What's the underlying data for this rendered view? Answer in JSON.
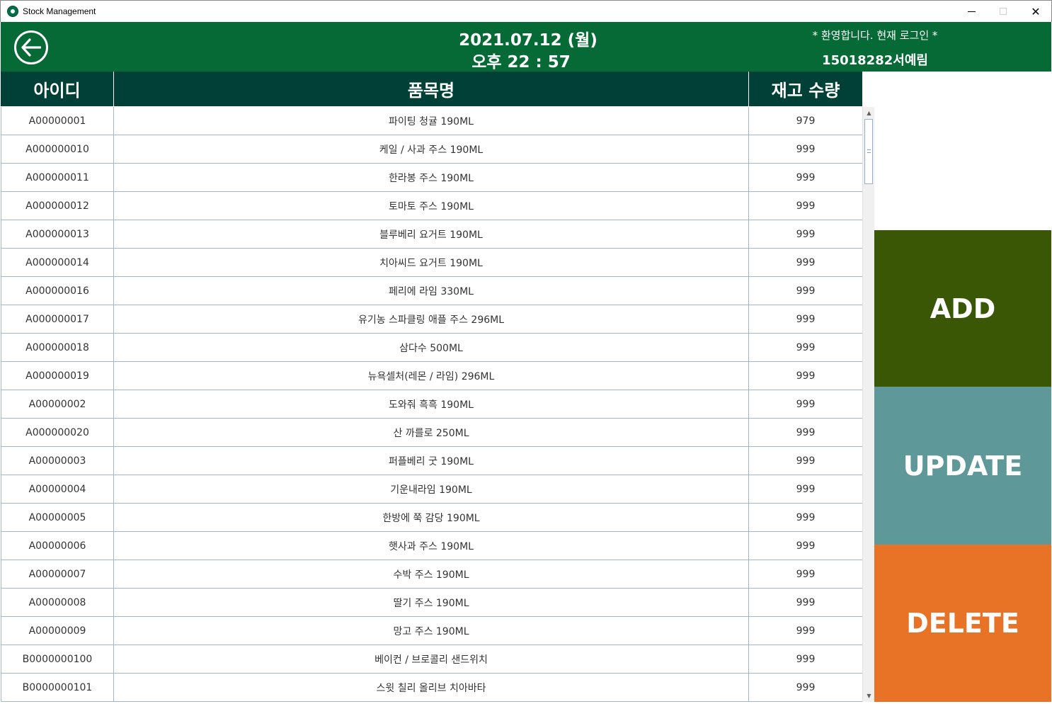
{
  "window": {
    "title": "Stock Management",
    "min_glyph": "",
    "max_glyph": "",
    "close_glyph": "✕"
  },
  "header": {
    "date": "2021.07.12 (월)",
    "time": "오후 22 : 57",
    "welcome": "* 환영합니다. 현재 로그인 *",
    "user": "15018282서예림"
  },
  "table": {
    "columns": [
      "아이디",
      "품목명",
      "재고 수량"
    ],
    "rows": [
      {
        "id": "A00000001",
        "name": "파이팅 청귤 190ML",
        "qty": "979"
      },
      {
        "id": "A000000010",
        "name": "케일 / 사과 주스 190ML",
        "qty": "999"
      },
      {
        "id": "A000000011",
        "name": "한라봉 주스 190ML",
        "qty": "999"
      },
      {
        "id": "A000000012",
        "name": "토마토 주스 190ML",
        "qty": "999"
      },
      {
        "id": "A000000013",
        "name": "블루베리 요거트 190ML",
        "qty": "999"
      },
      {
        "id": "A000000014",
        "name": "치아씨드 요거트 190ML",
        "qty": "999"
      },
      {
        "id": "A000000016",
        "name": "페리에 라임 330ML",
        "qty": "999"
      },
      {
        "id": "A000000017",
        "name": "유기농 스파클링 애플 주스 296ML",
        "qty": "999"
      },
      {
        "id": "A000000018",
        "name": "삼다수 500ML",
        "qty": "999"
      },
      {
        "id": "A000000019",
        "name": "뉴욕셀처(레몬 / 라임) 296ML",
        "qty": "999"
      },
      {
        "id": "A00000002",
        "name": "도와줘 흑흑 190ML",
        "qty": "999"
      },
      {
        "id": "A000000020",
        "name": "산 까를로 250ML",
        "qty": "999"
      },
      {
        "id": "A00000003",
        "name": "퍼플베리 굿 190ML",
        "qty": "999"
      },
      {
        "id": "A00000004",
        "name": "기운내라임 190ML",
        "qty": "999"
      },
      {
        "id": "A00000005",
        "name": "한방에 쭉 감당 190ML",
        "qty": "999"
      },
      {
        "id": "A00000006",
        "name": "햇사과 주스 190ML",
        "qty": "999"
      },
      {
        "id": "A00000007",
        "name": "수박 주스 190ML",
        "qty": "999"
      },
      {
        "id": "A00000008",
        "name": "딸기 주스 190ML",
        "qty": "999"
      },
      {
        "id": "A00000009",
        "name": "망고 주스 190ML",
        "qty": "999"
      },
      {
        "id": "B0000000100",
        "name": "베이컨 / 브로콜리 샌드위치",
        "qty": "999"
      },
      {
        "id": "B0000000101",
        "name": "스윗 칠리 올리브 치아바타",
        "qty": "999"
      }
    ]
  },
  "actions": {
    "add": "ADD",
    "update": "UPDATE",
    "delete": "DELETE"
  },
  "colors": {
    "header_bg": "#056a36",
    "table_header_bg": "#004037",
    "add_bg": "#3a5706",
    "update_bg": "#5e9898",
    "delete_bg": "#e87326"
  },
  "icons": {
    "app": "starbucks-logo-icon",
    "back": "arrow-left-circle-icon"
  }
}
